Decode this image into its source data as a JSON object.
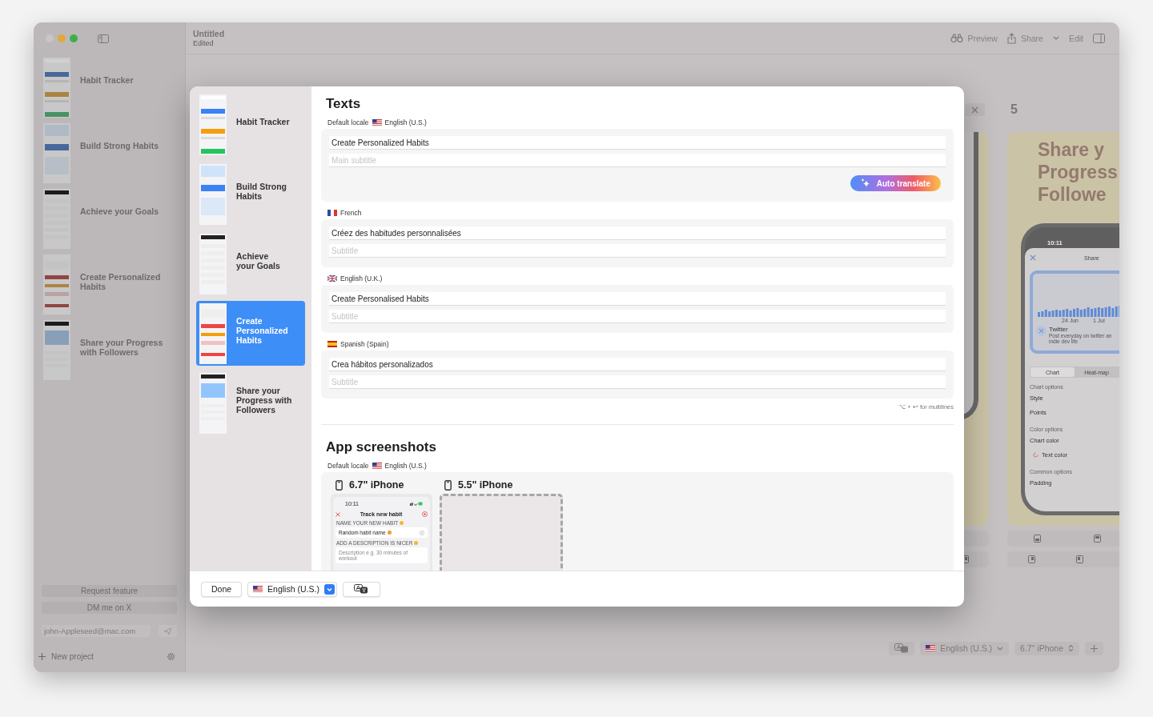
{
  "window": {
    "title": "Untitled",
    "subtitle": "Edited"
  },
  "sidebar": {
    "projects": [
      {
        "title": "Habit Tracker"
      },
      {
        "title": "Build Strong Habits"
      },
      {
        "title": "Achieve your Goals"
      },
      {
        "title": "Create Personalized Habits"
      },
      {
        "title": "Share your Progress with Followers"
      }
    ],
    "request_button": "Request feature",
    "dm_button": "DM me on X",
    "email": {
      "placeholder": "john-Appleseed@mac.com"
    },
    "new_project": "New project"
  },
  "toolbar": {
    "preview": "Preview",
    "share": "Share",
    "edit": "Edit"
  },
  "canvas": {
    "page_number": "5",
    "card_title": [
      "Share y",
      "Progress",
      "Followe"
    ],
    "phone": {
      "time": "10:11",
      "sheet_title": "Share",
      "chart_labels": [
        "24 Jun",
        "1 Jul"
      ],
      "account": "Twitter",
      "account_text": [
        "Post everyday on twitter an",
        "indie dev life"
      ],
      "segments": [
        {
          "label": "Chart",
          "selected": true
        },
        {
          "label": "Heat-map",
          "selected": false
        }
      ],
      "options": [
        {
          "kind": "header",
          "text": "Chart options"
        },
        {
          "kind": "row",
          "text": "Style"
        },
        {
          "kind": "row",
          "text": "Points"
        },
        {
          "kind": "header",
          "text": "Color options"
        },
        {
          "kind": "row",
          "text": "Chart color"
        },
        {
          "kind": "icon_row",
          "text": "Text color"
        },
        {
          "kind": "header",
          "text": "Common options"
        },
        {
          "kind": "row",
          "text": "Padding"
        }
      ]
    }
  },
  "bottom_bar": {
    "locale": {
      "kind": "us",
      "label": "English (U.S.)"
    },
    "device": "6.7\" iPhone"
  },
  "dialog": {
    "projects": [
      {
        "title": "Habit Tracker",
        "selected": false
      },
      {
        "title": "Build Strong\nHabits",
        "selected": false
      },
      {
        "title": "Achieve\nyour Goals",
        "selected": false
      },
      {
        "title": "Create\nPersonalized\nHabits",
        "selected": true
      },
      {
        "title": "Share your\nProgress with\nFollowers",
        "selected": false
      }
    ],
    "texts_title": "Texts",
    "locales": [
      {
        "prefix": "Default locale",
        "kind": "us",
        "name": "English (U.S.)",
        "title": "Create Personalized Habits",
        "subtitle_placeholder": "Main subtitle"
      },
      {
        "kind": "fr",
        "name": "French",
        "title": "Créez des habitudes personnalisées",
        "subtitle_placeholder": "Subtitle"
      },
      {
        "kind": "gb",
        "name": "English (U.K.)",
        "title": "Create Personalised Habits",
        "subtitle_placeholder": "Subtitle"
      },
      {
        "kind": "es",
        "name": "Spanish (Spain)",
        "title": "Crea hábitos personalizados",
        "subtitle_placeholder": "Subtitle"
      }
    ],
    "auto_translate": "Auto translate",
    "hint": "⌥ + ↩ for multilines",
    "screenshots_title": "App screenshots",
    "screenshots_locale": {
      "prefix": "Default locale",
      "kind": "us",
      "name": "English (U.S.)"
    },
    "devices": [
      {
        "kind": "preview",
        "name": "6.7\" iPhone",
        "screen": {
          "time": "10:11",
          "title": "Track new habit",
          "name_label": "NAME YOUR NEW HABIT",
          "name_value": "Random habit name",
          "description_label": "ADD A DESCRIPTION IS NICER",
          "description_placeholder": "Description e.g. 30 minutes of workout"
        }
      },
      {
        "kind": "drop_zone",
        "name": "5.5\" iPhone"
      }
    ],
    "footer": {
      "done": "Done",
      "locale": {
        "kind": "us",
        "label": "English (U.S.)"
      }
    }
  }
}
